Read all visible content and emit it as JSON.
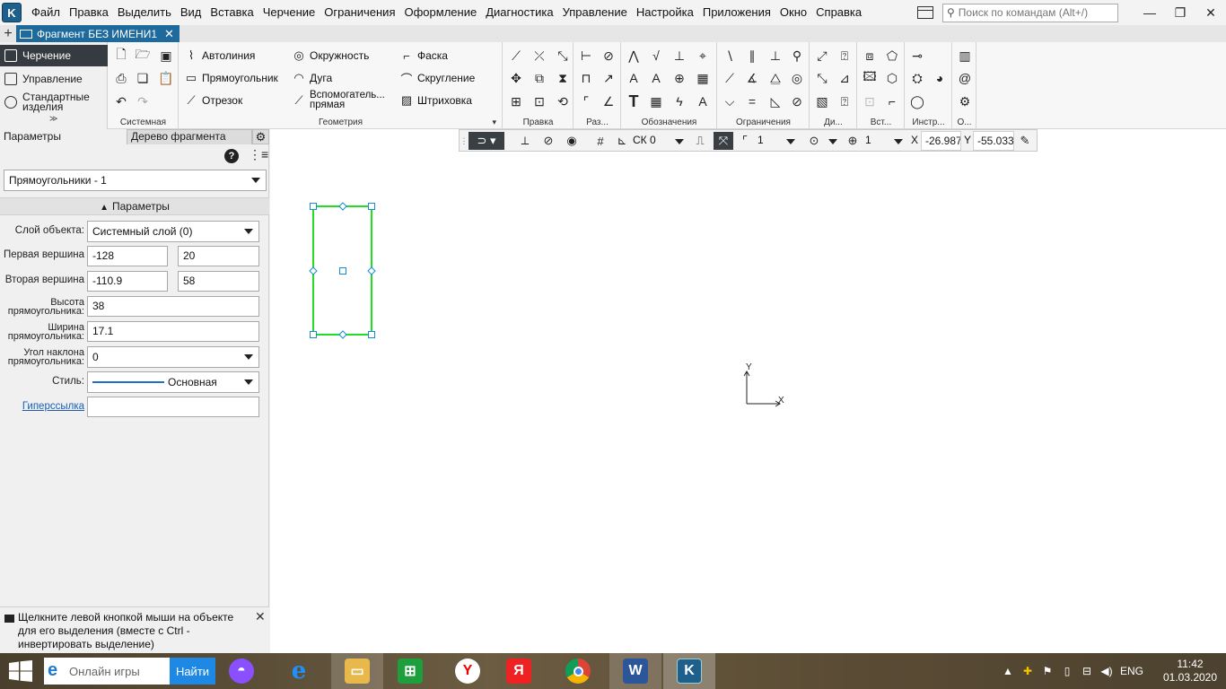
{
  "menu": {
    "items": [
      "Файл",
      "Правка",
      "Выделить",
      "Вид",
      "Вставка",
      "Черчение",
      "Ограничения",
      "Оформление",
      "Диагностика",
      "Управление",
      "Настройка",
      "Приложения",
      "Окно",
      "Справка"
    ],
    "search_placeholder": "Поиск по командам (Alt+/)",
    "win_min": "—",
    "win_max": "❐",
    "win_close": "✕"
  },
  "tabbar": {
    "add": "+",
    "doc_title": "Фрагмент БЕЗ ИМЕНИ1",
    "close": "✕"
  },
  "modes": {
    "items": [
      "Черчение",
      "Управление",
      "Стандартные изделия"
    ],
    "active": 0,
    "more": "≫"
  },
  "ribbon": {
    "groups": {
      "system": "Системная",
      "geometry": "Геометрия",
      "edit": "Правка",
      "dims": "Раз...",
      "notation": "Обозначения",
      "constraints": "Ограничения",
      "diag": "Ди...",
      "insert": "Вст...",
      "tools": "Инстр...",
      "other": "О..."
    },
    "geometry_buttons": [
      "Автолиния",
      "Прямоугольник",
      "Отрезок",
      "Окружность",
      "Дуга",
      "Вспомогатель...",
      "прямая",
      "Фаска",
      "Скругление",
      "Штриховка"
    ]
  },
  "left_panel": {
    "tab_params": "Параметры",
    "tab_tree": "Дерево фрагмента",
    "gear": "⚙",
    "help": "?",
    "object_select": "Прямоугольники - 1",
    "section_title": "Параметры",
    "layer_label": "Слой объекта:",
    "layer_value": "Системный слой (0)",
    "first_vertex_label": "Первая вершина",
    "first_vertex_x": "-128",
    "first_vertex_y": "20",
    "second_vertex_label": "Вторая вершина",
    "second_vertex_x": "-110.9",
    "second_vertex_y": "58",
    "height_label_1": "Высота",
    "height_label_2": "прямоугольника:",
    "height_value": "38",
    "width_label_1": "Ширина",
    "width_label_2": "прямоугольника:",
    "width_value": "17.1",
    "angle_label_1": "Угол наклона",
    "angle_label_2": "прямоугольника:",
    "angle_value": "0",
    "style_label": "Стиль:",
    "style_value": "Основная",
    "hyperlink_label": "Гиперссылка",
    "hyperlink_value": "",
    "hint": "Щелкните левой кнопкой мыши на объекте для его выделения (вместе с Ctrl - инвертировать выделение)",
    "hint_close": "✕"
  },
  "snapbar": {
    "cs": "СК 0",
    "step": "1",
    "zoom": "1",
    "x_label": "X",
    "x_value": "-26.987",
    "y_label": "Y",
    "y_value": "-55.033"
  },
  "axes": {
    "x": "X",
    "y": "Y"
  },
  "colors": {
    "selection": "#22dd22",
    "active_tab": "#1e6a9c",
    "mode_active": "#353b40",
    "style_line": "#1f6fc5"
  },
  "taskbar": {
    "search_placeholder": "Онлайн игры",
    "search_button": "Найти",
    "tray_lang": "ENG",
    "time": "11:42",
    "date": "01.03.2020"
  }
}
